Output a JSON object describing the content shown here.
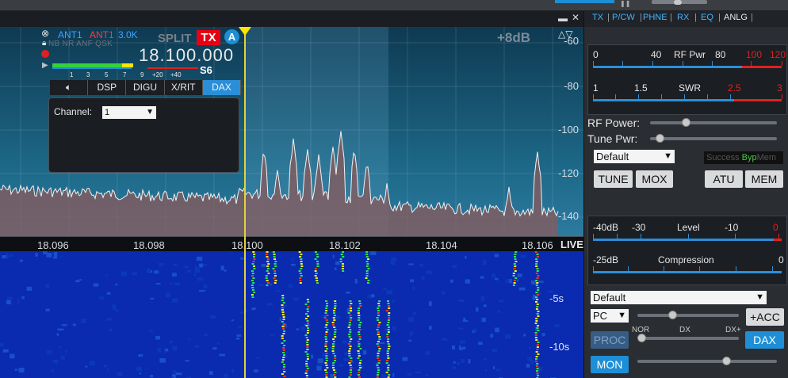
{
  "pan": {
    "db_indicator": "+8dB",
    "y_labels": [
      "-60",
      "-80",
      "-100",
      "-120",
      "-140"
    ],
    "x_labels": [
      "18.096",
      "18.098",
      "18.100",
      "18.102",
      "18.104",
      "18.106"
    ],
    "live": "LIVE",
    "waterfall_labels": [
      "-5s",
      "-10s"
    ]
  },
  "slice": {
    "ant_rx": "ANT1",
    "ant_tx": "ANT1",
    "bandwidth": "3.0K",
    "modes": "NB NR ANF QSK",
    "split": "SPLIT",
    "tx": "TX",
    "slice_letter": "A",
    "frequency": "18.100.000",
    "s_value": "S6",
    "s_ticks": [
      "1",
      "3",
      "5",
      "7",
      "9",
      "+20",
      "+40"
    ],
    "tabs": [
      "DSP",
      "DIGU",
      "X/RIT",
      "DAX"
    ],
    "active_tab": "DAX",
    "dax": {
      "channel_label": "Channel:",
      "channel_value": "1"
    }
  },
  "right_panel": {
    "tabs": [
      "TX",
      "P/CW",
      "PHNE",
      "RX",
      "EQ",
      "ANLG"
    ],
    "rf_meter": {
      "ticks": [
        "0",
        "40",
        "80",
        "100",
        "120"
      ],
      "label": "RF Pwr"
    },
    "swr_meter": {
      "ticks": [
        "1",
        "1.5",
        "2.5",
        "3"
      ],
      "label": "SWR"
    },
    "rf_power_label": "RF Power:",
    "rf_power_value": 0.27,
    "tune_pwr_label": "Tune Pwr:",
    "tune_pwr_value": 0.05,
    "profile": "Default",
    "atu_status": {
      "success": "Success",
      "byp": "Byp",
      "mem": "Mem"
    },
    "buttons": {
      "tune": "TUNE",
      "mox": "MOX",
      "atu": "ATU",
      "mem": "MEM"
    },
    "level_meter": {
      "ticks": [
        "-40dB",
        "-30",
        "-10",
        "0"
      ],
      "label": "Level"
    },
    "compression_meter": {
      "ticks": [
        "-25dB",
        "0"
      ],
      "label": "Compression"
    },
    "mic_profile": "Default",
    "mic_source": "PC",
    "mic_level": 0.33,
    "acc": "+ACC",
    "proc_labels": [
      "NOR",
      "DX",
      "DX+"
    ],
    "proc_value": 0.0,
    "proc": "PROC",
    "dax": "DAX",
    "mon": "MON",
    "mon_level": 0.65
  },
  "colors": {
    "accent_blue": "#1e8fd6",
    "tx_red": "#e60012",
    "cursor_yellow": "#ffe400",
    "spectrum_fill": "#8a5a5a"
  }
}
